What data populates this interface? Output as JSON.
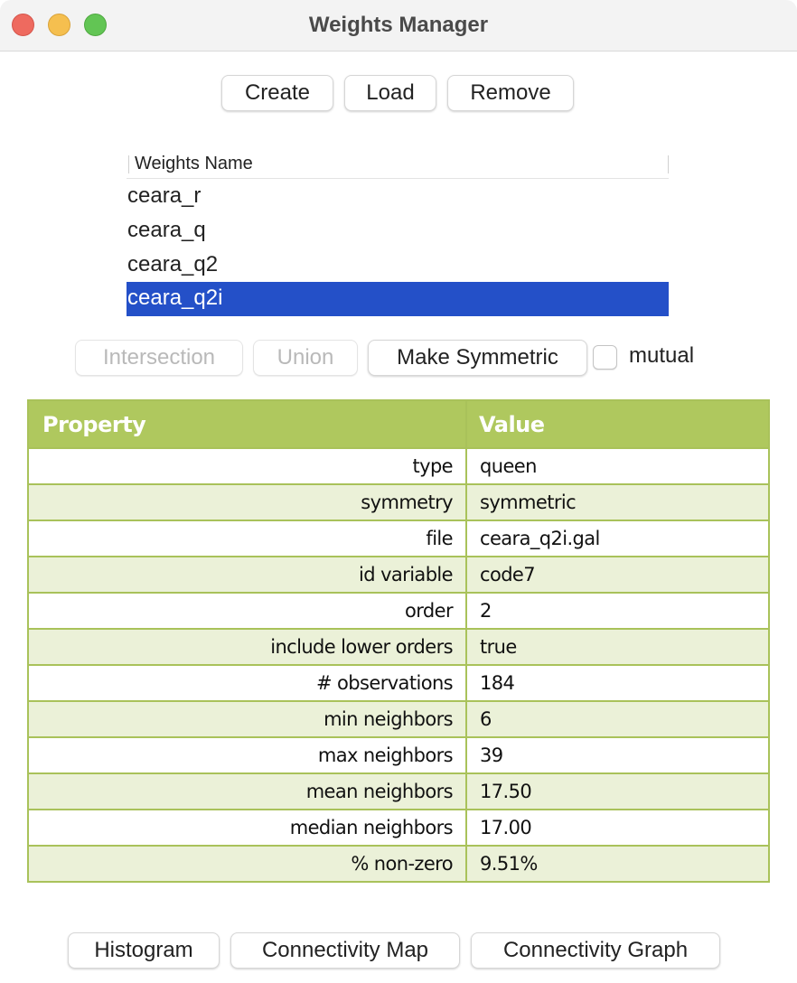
{
  "window": {
    "title": "Weights Manager",
    "controls": [
      "close",
      "minimize",
      "maximize"
    ]
  },
  "toolbar": {
    "create_label": "Create",
    "load_label": "Load",
    "remove_label": "Remove"
  },
  "weights_list": {
    "header": "Weights Name",
    "items": [
      {
        "name": "ceara_r",
        "selected": false
      },
      {
        "name": "ceara_q",
        "selected": false
      },
      {
        "name": "ceara_q2",
        "selected": false
      },
      {
        "name": "ceara_q2i",
        "selected": true
      }
    ],
    "selection_color": "#2450c8"
  },
  "operations": {
    "intersection_label": "Intersection",
    "intersection_enabled": false,
    "union_label": "Union",
    "union_enabled": false,
    "make_symmetric_label": "Make Symmetric",
    "mutual_label": "mutual",
    "mutual_checked": false
  },
  "properties": {
    "header_property": "Property",
    "header_value": "Value",
    "header_color": "#afc85e",
    "alt_row_color": "#ebf1d8",
    "rows": [
      {
        "property": "type",
        "value": "queen"
      },
      {
        "property": "symmetry",
        "value": "symmetric"
      },
      {
        "property": "file",
        "value": "ceara_q2i.gal"
      },
      {
        "property": "id variable",
        "value": "code7"
      },
      {
        "property": "order",
        "value": "2"
      },
      {
        "property": "include lower orders",
        "value": "true"
      },
      {
        "property": "# observations",
        "value": "184"
      },
      {
        "property": "min neighbors",
        "value": "6"
      },
      {
        "property": "max neighbors",
        "value": "39"
      },
      {
        "property": "mean neighbors",
        "value": "17.50"
      },
      {
        "property": "median neighbors",
        "value": "17.00"
      },
      {
        "property": "% non-zero",
        "value": "9.51%"
      }
    ]
  },
  "footer": {
    "histogram_label": "Histogram",
    "connectivity_map_label": "Connectivity Map",
    "connectivity_graph_label": "Connectivity Graph"
  }
}
